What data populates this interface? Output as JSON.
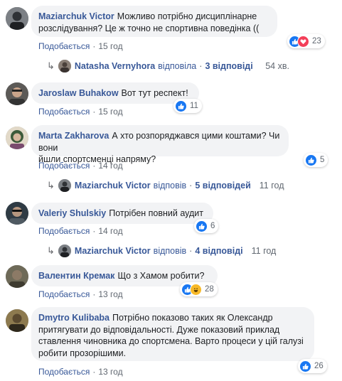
{
  "colors": {
    "link": "#385898",
    "bubble": "#f2f3f5",
    "like": "#1877f2",
    "love": "#f33e58",
    "haha": "#f7b928",
    "meta": "#606770"
  },
  "comments": [
    {
      "author": "Maziarchuk Victor",
      "line1": "Можливо потрібно дисциплінарне",
      "line2": "розслідування? Це ж точно не спортивна поведінка ((",
      "reactions": [
        "like",
        "love"
      ],
      "reaction_count": "23",
      "like_label": "Подобається",
      "time": "15 год"
    },
    {
      "author": "Jaroslaw Buhakow",
      "line1": "Вот тут респект!",
      "reactions": [
        "like"
      ],
      "reaction_count": "11",
      "like_label": "Подобається",
      "time": "15 год"
    },
    {
      "author": "Marta Zakharova",
      "line1": "А хто розпоряджався цими коштами? Чи вони",
      "line2": "йшли спортсменці напряму?",
      "reactions": [
        "like"
      ],
      "reaction_count": "5",
      "like_label": "Подобається",
      "time": "14 год"
    },
    {
      "author": "Valeriy Shulskiy",
      "line1": "Потрібен повний аудит",
      "reactions": [
        "like"
      ],
      "reaction_count": "6",
      "like_label": "Подобається",
      "time": "14 год"
    },
    {
      "author": "Валентин Кремак",
      "line1": "Що з Хамом робити?",
      "reactions": [
        "like",
        "haha"
      ],
      "reaction_count": "28",
      "like_label": "Подобається",
      "time": "13 год"
    },
    {
      "author": "Dmytro Kulibaba",
      "line1": "Потрібно показово таких як Олександр",
      "line2": "притягувати до відповідальності. Дуже показовий приклад",
      "line3": "ставлення чиновника до спортсмена. Варто процеси у цій галузі",
      "line4": "робити прозорішими.",
      "reactions": [
        "like"
      ],
      "reaction_count": "26",
      "like_label": "Подобається",
      "time": "13 год"
    }
  ],
  "replies": [
    {
      "name": "Natasha Vernyhora",
      "verb": "відповіла",
      "count": "3 відповіді",
      "time": "54 хв."
    },
    {
      "name": "Maziarchuk Victor",
      "verb": "відповів",
      "count": "5 відповідей",
      "time": "11 год"
    },
    {
      "name": "Maziarchuk Victor",
      "verb": "відповів",
      "count": "4 відповіді",
      "time": "11 год"
    }
  ]
}
